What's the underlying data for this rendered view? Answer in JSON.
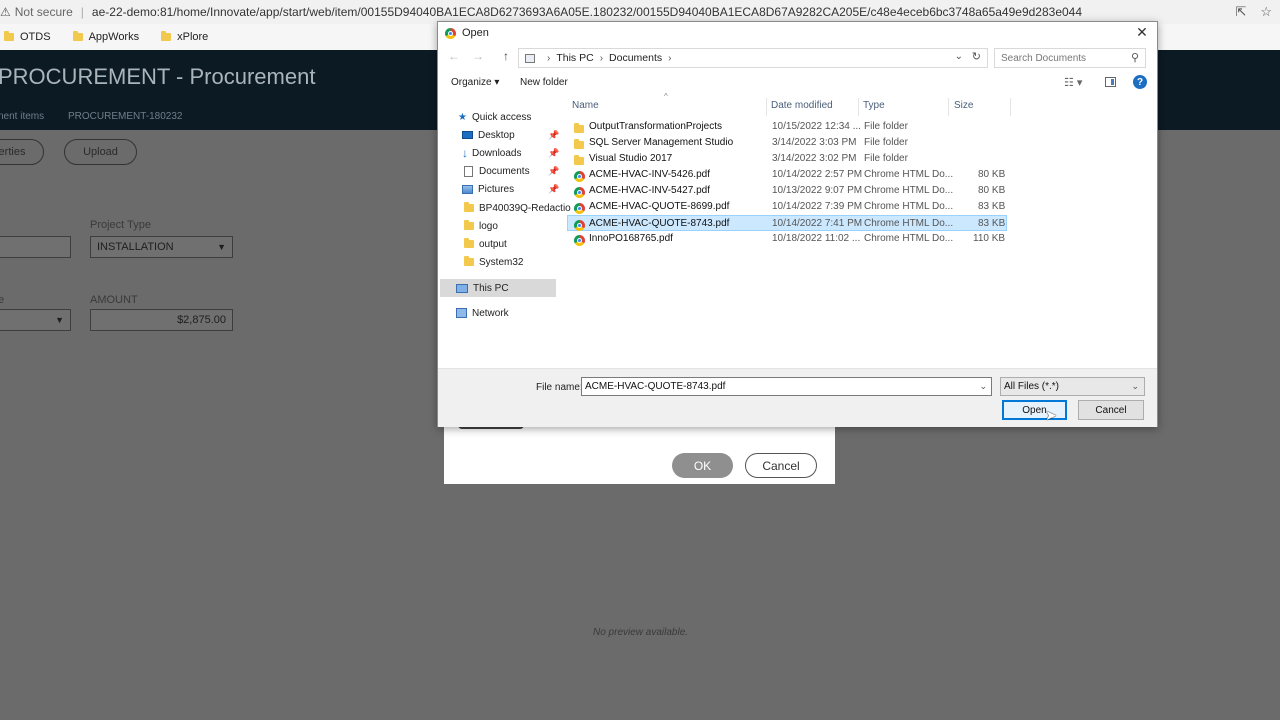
{
  "browser": {
    "security": "Not secure",
    "url": "ae-22-demo:81/home/Innovate/app/start/web/item/00155D94040BA1ECA8D6273693A6A05E.180232/00155D94040BA1ECA8D67A9282CA205E/c48e4eceb6bc3748a65a49e9d283e044",
    "bookmarks": [
      "OTDS",
      "AppWorks",
      "xPlore"
    ]
  },
  "app": {
    "title": "PROCUREMENT - Procurement",
    "breadcrumb1": "nent items",
    "breadcrumb2": "PROCUREMENT-180232",
    "properties_button": "erties",
    "upload_button": "Upload",
    "project_type_label": "Project Type",
    "project_type_value": "INSTALLATION",
    "amount_label": "AMOUNT",
    "amount_value": "$2,875.00",
    "left_label": "e",
    "no_preview": "No preview available."
  },
  "modal": {
    "ok": "OK",
    "cancel": "Cancel"
  },
  "dialog": {
    "title": "Open",
    "breadcrumb": [
      "This PC",
      "Documents"
    ],
    "search_placeholder": "Search Documents",
    "organize": "Organize ▾",
    "new_folder": "New folder",
    "nav": {
      "quick_access": "Quick access",
      "desktop": "Desktop",
      "downloads": "Downloads",
      "documents": "Documents",
      "pictures": "Pictures",
      "folder1": "BP40039Q-Redactio",
      "folder2": "logo",
      "folder3": "output",
      "folder4": "System32",
      "this_pc": "This PC",
      "network": "Network"
    },
    "columns": {
      "name": "Name",
      "date": "Date modified",
      "type": "Type",
      "size": "Size"
    },
    "files": [
      {
        "name": "OutputTransformationProjects",
        "date": "10/15/2022 12:34 ...",
        "type": "File folder",
        "size": "",
        "kind": "folder"
      },
      {
        "name": "SQL Server Management Studio",
        "date": "3/14/2022 3:03 PM",
        "type": "File folder",
        "size": "",
        "kind": "folder"
      },
      {
        "name": "Visual Studio 2017",
        "date": "3/14/2022 3:02 PM",
        "type": "File folder",
        "size": "",
        "kind": "folder"
      },
      {
        "name": "ACME-HVAC-INV-5426.pdf",
        "date": "10/14/2022 2:57 PM",
        "type": "Chrome HTML Do...",
        "size": "80 KB",
        "kind": "pdf"
      },
      {
        "name": "ACME-HVAC-INV-5427.pdf",
        "date": "10/13/2022 9:07 PM",
        "type": "Chrome HTML Do...",
        "size": "80 KB",
        "kind": "pdf"
      },
      {
        "name": "ACME-HVAC-QUOTE-8699.pdf",
        "date": "10/14/2022 7:39 PM",
        "type": "Chrome HTML Do...",
        "size": "83 KB",
        "kind": "pdf"
      },
      {
        "name": "ACME-HVAC-QUOTE-8743.pdf",
        "date": "10/14/2022 7:41 PM",
        "type": "Chrome HTML Do...",
        "size": "83 KB",
        "kind": "pdf",
        "selected": true
      },
      {
        "name": "InnoPO168765.pdf",
        "date": "10/18/2022 11:02 ...",
        "type": "Chrome HTML Do...",
        "size": "110 KB",
        "kind": "pdf"
      }
    ],
    "file_name_label": "File name:",
    "file_name_value": "ACME-HVAC-QUOTE-8743.pdf",
    "file_type": "All Files (*.*)",
    "open_button": "Open",
    "cancel_button": "Cancel"
  }
}
